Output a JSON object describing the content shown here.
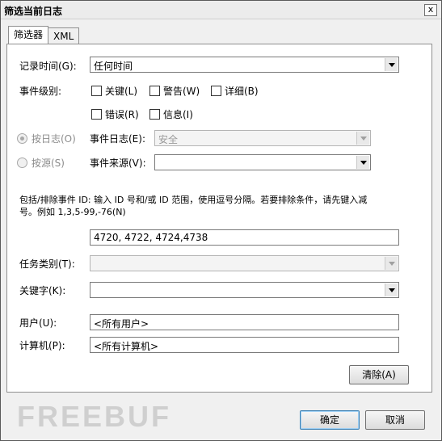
{
  "window": {
    "title": "筛选当前日志",
    "close": "x"
  },
  "tabs": [
    {
      "label": "筛选器"
    },
    {
      "label": "XML"
    }
  ],
  "logged": {
    "label": "记录时间(G):",
    "value": "任何时间"
  },
  "event_level": {
    "label": "事件级别:",
    "critical": "关键(L)",
    "warning": "警告(W)",
    "verbose": "详细(B)",
    "error": "错误(R)",
    "information": "信息(I)"
  },
  "by_log": {
    "label": "按日志(O)",
    "field_label": "事件日志(E):",
    "value": "安全"
  },
  "by_source": {
    "label": "按源(S)",
    "field_label": "事件来源(V):",
    "value": ""
  },
  "event_ids": {
    "help_line1": "包括/排除事件 ID: 输入 ID 号和/或 ID 范围，使用逗号分隔。若要排除条件，请先键入减",
    "help_line2": "号。例如 1,3,5-99,-76(N)",
    "value": "4720, 4722, 4724,4738"
  },
  "task_category": {
    "label": "任务类别(T):",
    "value": ""
  },
  "keywords": {
    "label": "关键字(K):",
    "value": ""
  },
  "user": {
    "label": "用户(U):",
    "value": "<所有用户>"
  },
  "computer": {
    "label": "计算机(P):",
    "value": "<所有计算机>"
  },
  "buttons": {
    "clear": "清除(A)",
    "ok": "确定",
    "cancel": "取消"
  },
  "watermark": "FREEBUF"
}
